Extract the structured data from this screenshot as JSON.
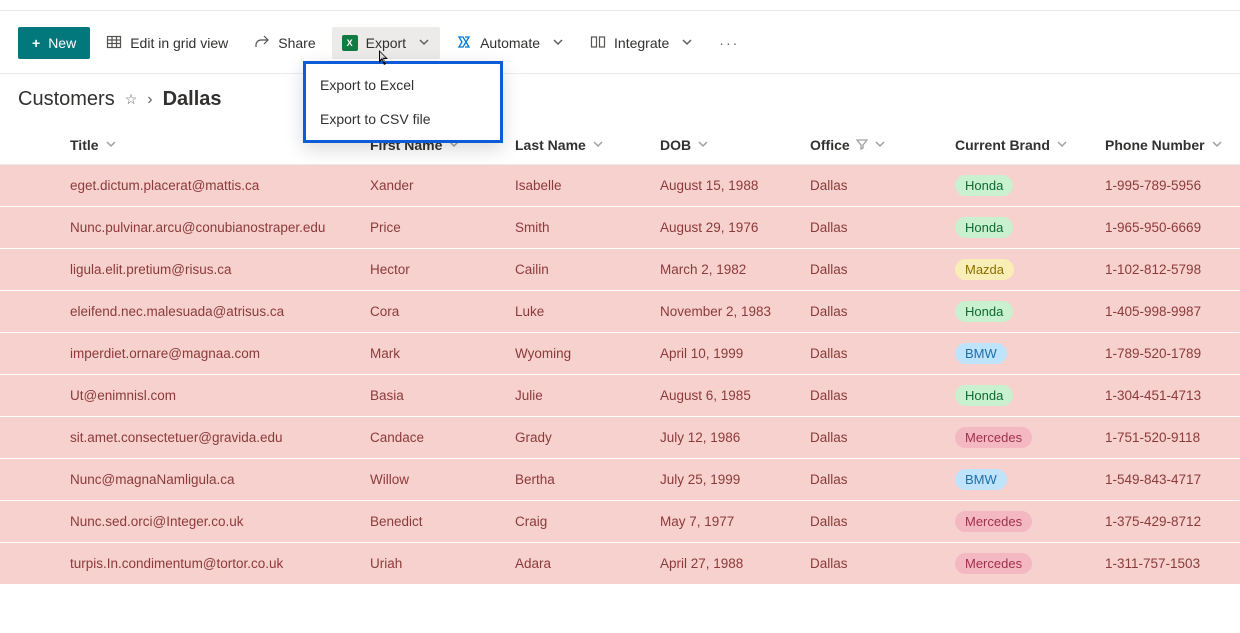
{
  "toolbar": {
    "new_label": "New",
    "edit_label": "Edit in grid view",
    "share_label": "Share",
    "export_label": "Export",
    "automate_label": "Automate",
    "integrate_label": "Integrate",
    "export_menu": {
      "to_excel": "Export to Excel",
      "to_csv": "Export to CSV file"
    }
  },
  "breadcrumb": {
    "root": "Customers",
    "leaf": "Dallas"
  },
  "columns": {
    "title": "Title",
    "first": "First Name",
    "last": "Last Name",
    "dob": "DOB",
    "office": "Office",
    "brand": "Current Brand",
    "phone": "Phone Number"
  },
  "rows": [
    {
      "title": "eget.dictum.placerat@mattis.ca",
      "first": "Xander",
      "last": "Isabelle",
      "dob": "August 15, 1988",
      "office": "Dallas",
      "brand": "Honda",
      "brandClass": "honda",
      "phone": "1-995-789-5956"
    },
    {
      "title": "Nunc.pulvinar.arcu@conubianostraper.edu",
      "first": "Price",
      "last": "Smith",
      "dob": "August 29, 1976",
      "office": "Dallas",
      "brand": "Honda",
      "brandClass": "honda",
      "phone": "1-965-950-6669"
    },
    {
      "title": "ligula.elit.pretium@risus.ca",
      "first": "Hector",
      "last": "Cailin",
      "dob": "March 2, 1982",
      "office": "Dallas",
      "brand": "Mazda",
      "brandClass": "mazda",
      "phone": "1-102-812-5798"
    },
    {
      "title": "eleifend.nec.malesuada@atrisus.ca",
      "first": "Cora",
      "last": "Luke",
      "dob": "November 2, 1983",
      "office": "Dallas",
      "brand": "Honda",
      "brandClass": "honda",
      "phone": "1-405-998-9987"
    },
    {
      "title": "imperdiet.ornare@magnaa.com",
      "first": "Mark",
      "last": "Wyoming",
      "dob": "April 10, 1999",
      "office": "Dallas",
      "brand": "BMW",
      "brandClass": "bmw",
      "phone": "1-789-520-1789"
    },
    {
      "title": "Ut@enimnisl.com",
      "first": "Basia",
      "last": "Julie",
      "dob": "August 6, 1985",
      "office": "Dallas",
      "brand": "Honda",
      "brandClass": "honda",
      "phone": "1-304-451-4713"
    },
    {
      "title": "sit.amet.consectetuer@gravida.edu",
      "first": "Candace",
      "last": "Grady",
      "dob": "July 12, 1986",
      "office": "Dallas",
      "brand": "Mercedes",
      "brandClass": "mercedes",
      "phone": "1-751-520-9118"
    },
    {
      "title": "Nunc@magnaNamligula.ca",
      "first": "Willow",
      "last": "Bertha",
      "dob": "July 25, 1999",
      "office": "Dallas",
      "brand": "BMW",
      "brandClass": "bmw",
      "phone": "1-549-843-4717"
    },
    {
      "title": "Nunc.sed.orci@Integer.co.uk",
      "first": "Benedict",
      "last": "Craig",
      "dob": "May 7, 1977",
      "office": "Dallas",
      "brand": "Mercedes",
      "brandClass": "mercedes",
      "phone": "1-375-429-8712"
    },
    {
      "title": "turpis.In.condimentum@tortor.co.uk",
      "first": "Uriah",
      "last": "Adara",
      "dob": "April 27, 1988",
      "office": "Dallas",
      "brand": "Mercedes",
      "brandClass": "mercedes",
      "phone": "1-311-757-1503"
    }
  ]
}
